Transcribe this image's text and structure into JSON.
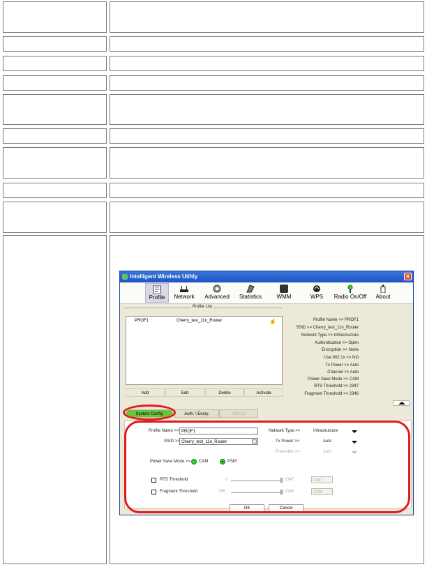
{
  "app": {
    "title": "Intelligent Wireless Utiltiy",
    "close_glyph": "✕"
  },
  "toolbar": {
    "items": [
      {
        "label": "Profile",
        "icon": "profile-icon",
        "active": true
      },
      {
        "label": "Network",
        "icon": "network-icon"
      },
      {
        "label": "Advanced",
        "icon": "advanced-icon"
      },
      {
        "label": "Statistics",
        "icon": "statistics-icon"
      },
      {
        "label": "WMM",
        "icon": "wmm-icon"
      },
      {
        "label": "WPS",
        "icon": "wps-icon"
      },
      {
        "label": "Radio On/Off",
        "icon": "radio-icon"
      },
      {
        "label": "About",
        "icon": "about-icon"
      }
    ]
  },
  "profile_list": {
    "title": "Profile List",
    "rows": [
      {
        "name": "PROF1",
        "ssid": "Cherry_test_11n_Router",
        "icon": "connected-icon"
      }
    ],
    "buttons": [
      "Add",
      "Edit",
      "Delete",
      "Activate"
    ]
  },
  "profile_info": [
    "Profile Name >> PROF1",
    "SSID >> Cherry_test_11n_Router",
    "Network Type >> Infrastructure",
    "Authentication >> Open",
    "Encryption >> None",
    "Use 802.1x >> NO",
    "Tx Power >> Auto",
    "Channel >> Auto",
    "Power Save Mode >> CAM",
    "RTS Threshold >> 2347",
    "Fragment Threshold >> 2346"
  ],
  "tabs": [
    {
      "label": "System Config",
      "active": true
    },
    {
      "label": "Auth. \\ Encry."
    },
    {
      "label": "802.1x",
      "disabled": true
    }
  ],
  "system_config": {
    "profile_name_label": "Profile Name >>",
    "profile_name_value": "PROF1",
    "ssid_label": "SSID >>",
    "ssid_value": "Cherry_test_11n_Router",
    "network_type_label": "Network Type >>",
    "network_type_value": "Infrastructure",
    "tx_power_label": "Tx Power >>",
    "tx_power_value": "Auto",
    "preamble_label": "Preamble >>",
    "preamble_value": "Auto",
    "power_save_label": "Power Save Mode >>",
    "power_save_options": [
      "CAM",
      "PSM"
    ],
    "power_save_selected": "PSM",
    "rts_label": "RTS Threshold",
    "rts_min": "0",
    "rts_max": "2347",
    "rts_value": "2347",
    "frag_label": "Fragment Threshold",
    "frag_min": "256",
    "frag_max": "2346",
    "frag_value": "2346"
  },
  "dialog_buttons": {
    "ok": "OK",
    "cancel": "Cancel"
  },
  "colors": {
    "highlight": "#e01b1b",
    "active_tab": "#6cc33d",
    "titlebar": "#1f52c6"
  }
}
